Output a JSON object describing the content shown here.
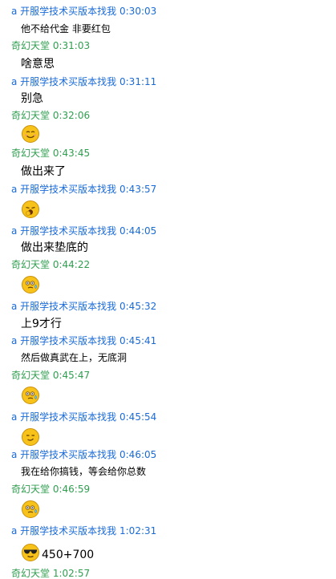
{
  "chat": {
    "messages": [
      {
        "sender": "a 开服学技术买版本找我",
        "time": "0:30:03",
        "color": "blue",
        "text": "他不给代金  非要红包"
      },
      {
        "sender": "奇幻天堂",
        "time": "0:31:03",
        "color": "green",
        "text": "啥意思"
      },
      {
        "sender": "a 开服学技术买版本找我",
        "time": "0:31:11",
        "color": "blue",
        "text": "别急"
      },
      {
        "sender": "奇幻天堂",
        "time": "0:32:06",
        "color": "green",
        "emoji": "smile-icon"
      },
      {
        "sender": "奇幻天堂",
        "time": "0:43:45",
        "color": "green",
        "text": "做出来了"
      },
      {
        "sender": "a 开服学技术买版本找我",
        "time": "0:43:57",
        "color": "blue",
        "emoji": "yawn-icon"
      },
      {
        "sender": "a 开服学技术买版本找我",
        "time": "0:44:05",
        "color": "blue",
        "text": "做出来垫底的"
      },
      {
        "sender": "奇幻天堂",
        "time": "0:44:22",
        "color": "green",
        "emoji": "sweat-icon"
      },
      {
        "sender": "a 开服学技术买版本找我",
        "time": "0:45:32",
        "color": "blue",
        "text": "上9才行"
      },
      {
        "sender": "a 开服学技术买版本找我",
        "time": "0:45:41",
        "color": "blue",
        "text": "然后做真武在上，无底洞"
      },
      {
        "sender": "奇幻天堂",
        "time": "0:45:47",
        "color": "green",
        "emoji": "sweat-icon"
      },
      {
        "sender": "a 开服学技术买版本找我",
        "time": "0:45:54",
        "color": "blue",
        "emoji": "smirk-icon"
      },
      {
        "sender": "a 开服学技术买版本找我",
        "time": "0:46:05",
        "color": "blue",
        "text": "我在给你搞钱，等会给你总数"
      },
      {
        "sender": "奇幻天堂",
        "time": "0:46:59",
        "color": "green",
        "emoji": "sweat-icon"
      },
      {
        "sender": "a 开服学技术买版本找我",
        "time": "1:02:31",
        "color": "blue",
        "emoji": "cool-icon",
        "text": "450+700"
      },
      {
        "sender": "奇幻天堂",
        "time": "1:02:57",
        "color": "green"
      }
    ]
  },
  "colors": {
    "blue_sender": "#1a6bd6",
    "green_sender": "#2f9e4f",
    "emoji_yellow": "#f7c21a"
  }
}
